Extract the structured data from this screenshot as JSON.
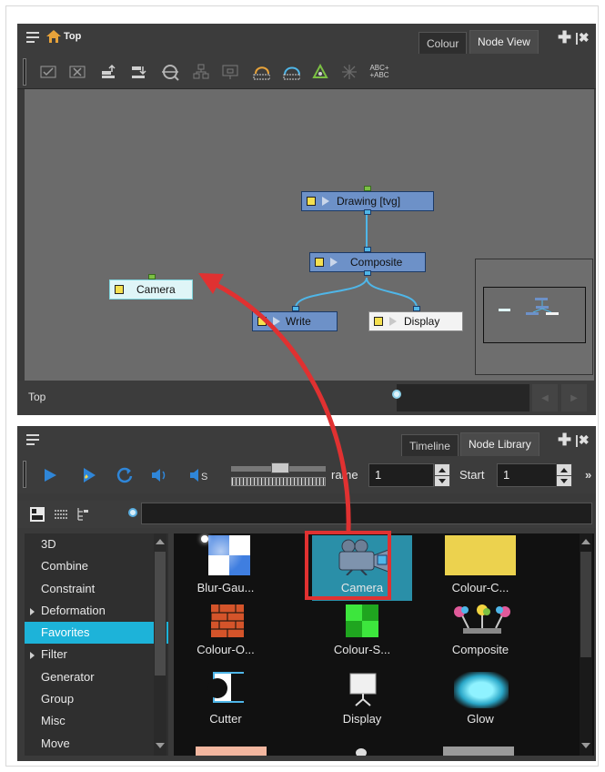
{
  "node_view_panel": {
    "breadcrumb": "Top",
    "tabs": [
      {
        "label": "Colour",
        "active": false
      },
      {
        "label": "Node View",
        "active": true
      }
    ],
    "toolbar_icons": [
      "enable-icon",
      "disable-icon",
      "move-up-icon",
      "move-down-icon",
      "find-icon",
      "group-icon",
      "ungroup-icon",
      "create-node-icon",
      "cable-icon",
      "peg-icon",
      "move-to-parent-icon",
      "abc-rename-icon"
    ],
    "nodes": [
      {
        "name": "Drawing [tvg]",
        "style": "blue"
      },
      {
        "name": "Composite",
        "style": "blue"
      },
      {
        "name": "Write",
        "style": "blue"
      },
      {
        "name": "Display",
        "style": "white"
      },
      {
        "name": "Camera",
        "style": "selected"
      }
    ],
    "status_text": "Top",
    "search_value": ""
  },
  "node_library_panel": {
    "tabs": [
      {
        "label": "Timeline",
        "active": false
      },
      {
        "label": "Node Library",
        "active": true
      }
    ],
    "frame_label": "rame",
    "frame_value": "1",
    "start_label": "Start",
    "start_value": "1",
    "search_value": "",
    "categories": [
      {
        "label": "3D",
        "expandable": false,
        "active": false
      },
      {
        "label": "Combine",
        "expandable": false,
        "active": false
      },
      {
        "label": "Constraint",
        "expandable": false,
        "active": false
      },
      {
        "label": "Deformation",
        "expandable": true,
        "active": false
      },
      {
        "label": "Favorites",
        "expandable": false,
        "active": true
      },
      {
        "label": "Filter",
        "expandable": true,
        "active": false
      },
      {
        "label": "Generator",
        "expandable": false,
        "active": false
      },
      {
        "label": "Group",
        "expandable": false,
        "active": false
      },
      {
        "label": "Misc",
        "expandable": false,
        "active": false
      },
      {
        "label": "Move",
        "expandable": false,
        "active": false
      }
    ],
    "tiles": [
      {
        "label": "Blur-Gau..."
      },
      {
        "label": "Camera",
        "highlighted": true
      },
      {
        "label": "Colour-C..."
      },
      {
        "label": "Colour-O..."
      },
      {
        "label": "Colour-S..."
      },
      {
        "label": "Composite"
      },
      {
        "label": "Cutter"
      },
      {
        "label": "Display"
      },
      {
        "label": "Glow"
      }
    ]
  },
  "colors": {
    "accent": "#1db3d9",
    "annotation": "#e03131",
    "node_blue": "#6d91c8",
    "port_blue": "#4fb6e8"
  }
}
